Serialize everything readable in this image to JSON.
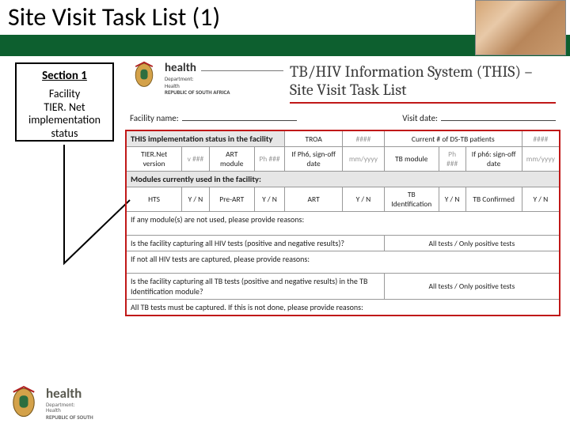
{
  "title": "Site Visit Task List (1)",
  "sidebar": {
    "section_label": "Section 1",
    "caption_l1": "Facility",
    "caption_l2": "TIER. Net",
    "caption_l3": "implementation",
    "caption_l4": "status"
  },
  "brand": {
    "name": "health",
    "dept_l1": "Department:",
    "dept_l2": "Health",
    "dept_l3": "REPUBLIC OF SOUTH AFRICA"
  },
  "doc_title_l1": "TB/HIV Information System (THIS) –",
  "doc_title_l2": "Site Visit Task List",
  "meta": {
    "facility_label": "Facility name:",
    "visit_label": "Visit date:"
  },
  "table": {
    "r1_a": "THIS implementation status in the facility",
    "r1_b": "TROA",
    "r1_c": "####",
    "r1_d": "Current # of DS-TB patients",
    "r1_e": "####",
    "r2_a": "TIER.Net version",
    "r2_av": "v ###",
    "r2_b": "ART module",
    "r2_bv": "Ph ###",
    "r2_c": "If Ph6, sign-off date",
    "r2_cv": "mm/yyyy",
    "r2_d": "TB module",
    "r2_dv": "Ph ###",
    "r2_e": "If ph6: sign-off date",
    "r2_ev": "mm/yyyy",
    "r3": "Modules currently used in the facility:",
    "r4_a": "HTS",
    "r4_b": "Pre-ART",
    "r4_c": "ART",
    "r4_d": "TB Identification",
    "r4_e": "TB Confirmed",
    "yn": "Y / N",
    "r5": "If any module(s) are not used, please provide reasons:",
    "r6_q": "Is the facility capturing all HIV tests (positive and negative results)?",
    "r6_a": "All tests / Only positive tests",
    "r7": "If not all HIV tests are captured, please provide reasons:",
    "r8_q": "Is the facility capturing all TB tests (positive and negative results) in the TB Identification module?",
    "r8_a": "All tests / Only positive tests",
    "r9": "All TB tests must be captured. If this is not done, please provide reasons:"
  },
  "footer": {
    "name": "health",
    "l1": "Department:",
    "l2": "Health",
    "l3": "REPUBLIC OF SOUTH"
  }
}
